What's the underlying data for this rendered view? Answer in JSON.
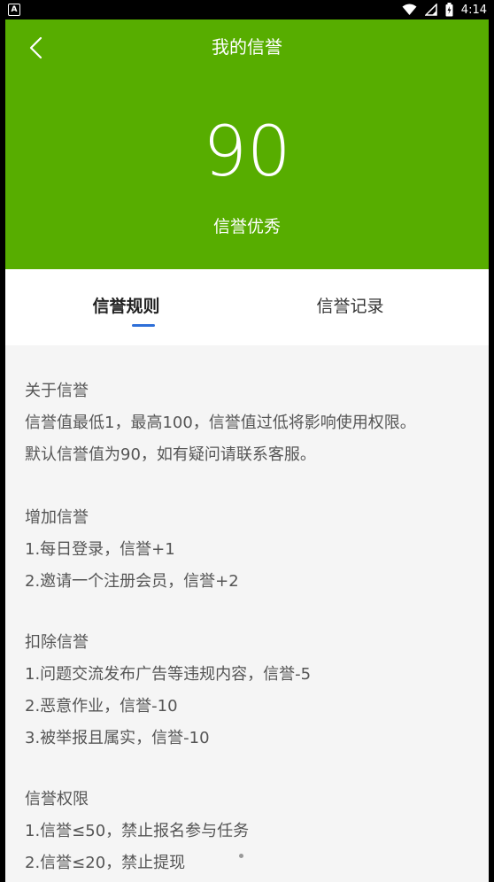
{
  "status_bar": {
    "left_badge": "A",
    "time": "4:14"
  },
  "header": {
    "title": "我的信誉",
    "score": "90",
    "level": "信誉优秀"
  },
  "tabs": [
    {
      "label": "信誉规则"
    },
    {
      "label": "信誉记录"
    }
  ],
  "sections": [
    {
      "title": "关于信誉",
      "lines": [
        "信誉值最低1，最高100，信誉值过低将影响使用权限。",
        "默认信誉值为90，如有疑问请联系客服。"
      ]
    },
    {
      "title": "增加信誉",
      "lines": [
        "1.每日登录，信誉+1",
        "2.邀请一个注册会员，信誉+2"
      ]
    },
    {
      "title": "扣除信誉",
      "lines": [
        "1.问题交流发布广告等违规内容，信誉-5",
        "2.恶意作业，信誉-10",
        "3.被举报且属实，信誉-10"
      ]
    },
    {
      "title": "信誉权限",
      "lines": [
        "1.信誉≤50，禁止报名参与任务",
        "2.信誉≤20，禁止提现"
      ]
    }
  ],
  "colors": {
    "header_green": "#57ad00",
    "tab_indicator": "#2e6fd8"
  },
  "icons": [
    "back-arrow-icon",
    "wifi-icon",
    "signal-icon",
    "battery-icon"
  ]
}
